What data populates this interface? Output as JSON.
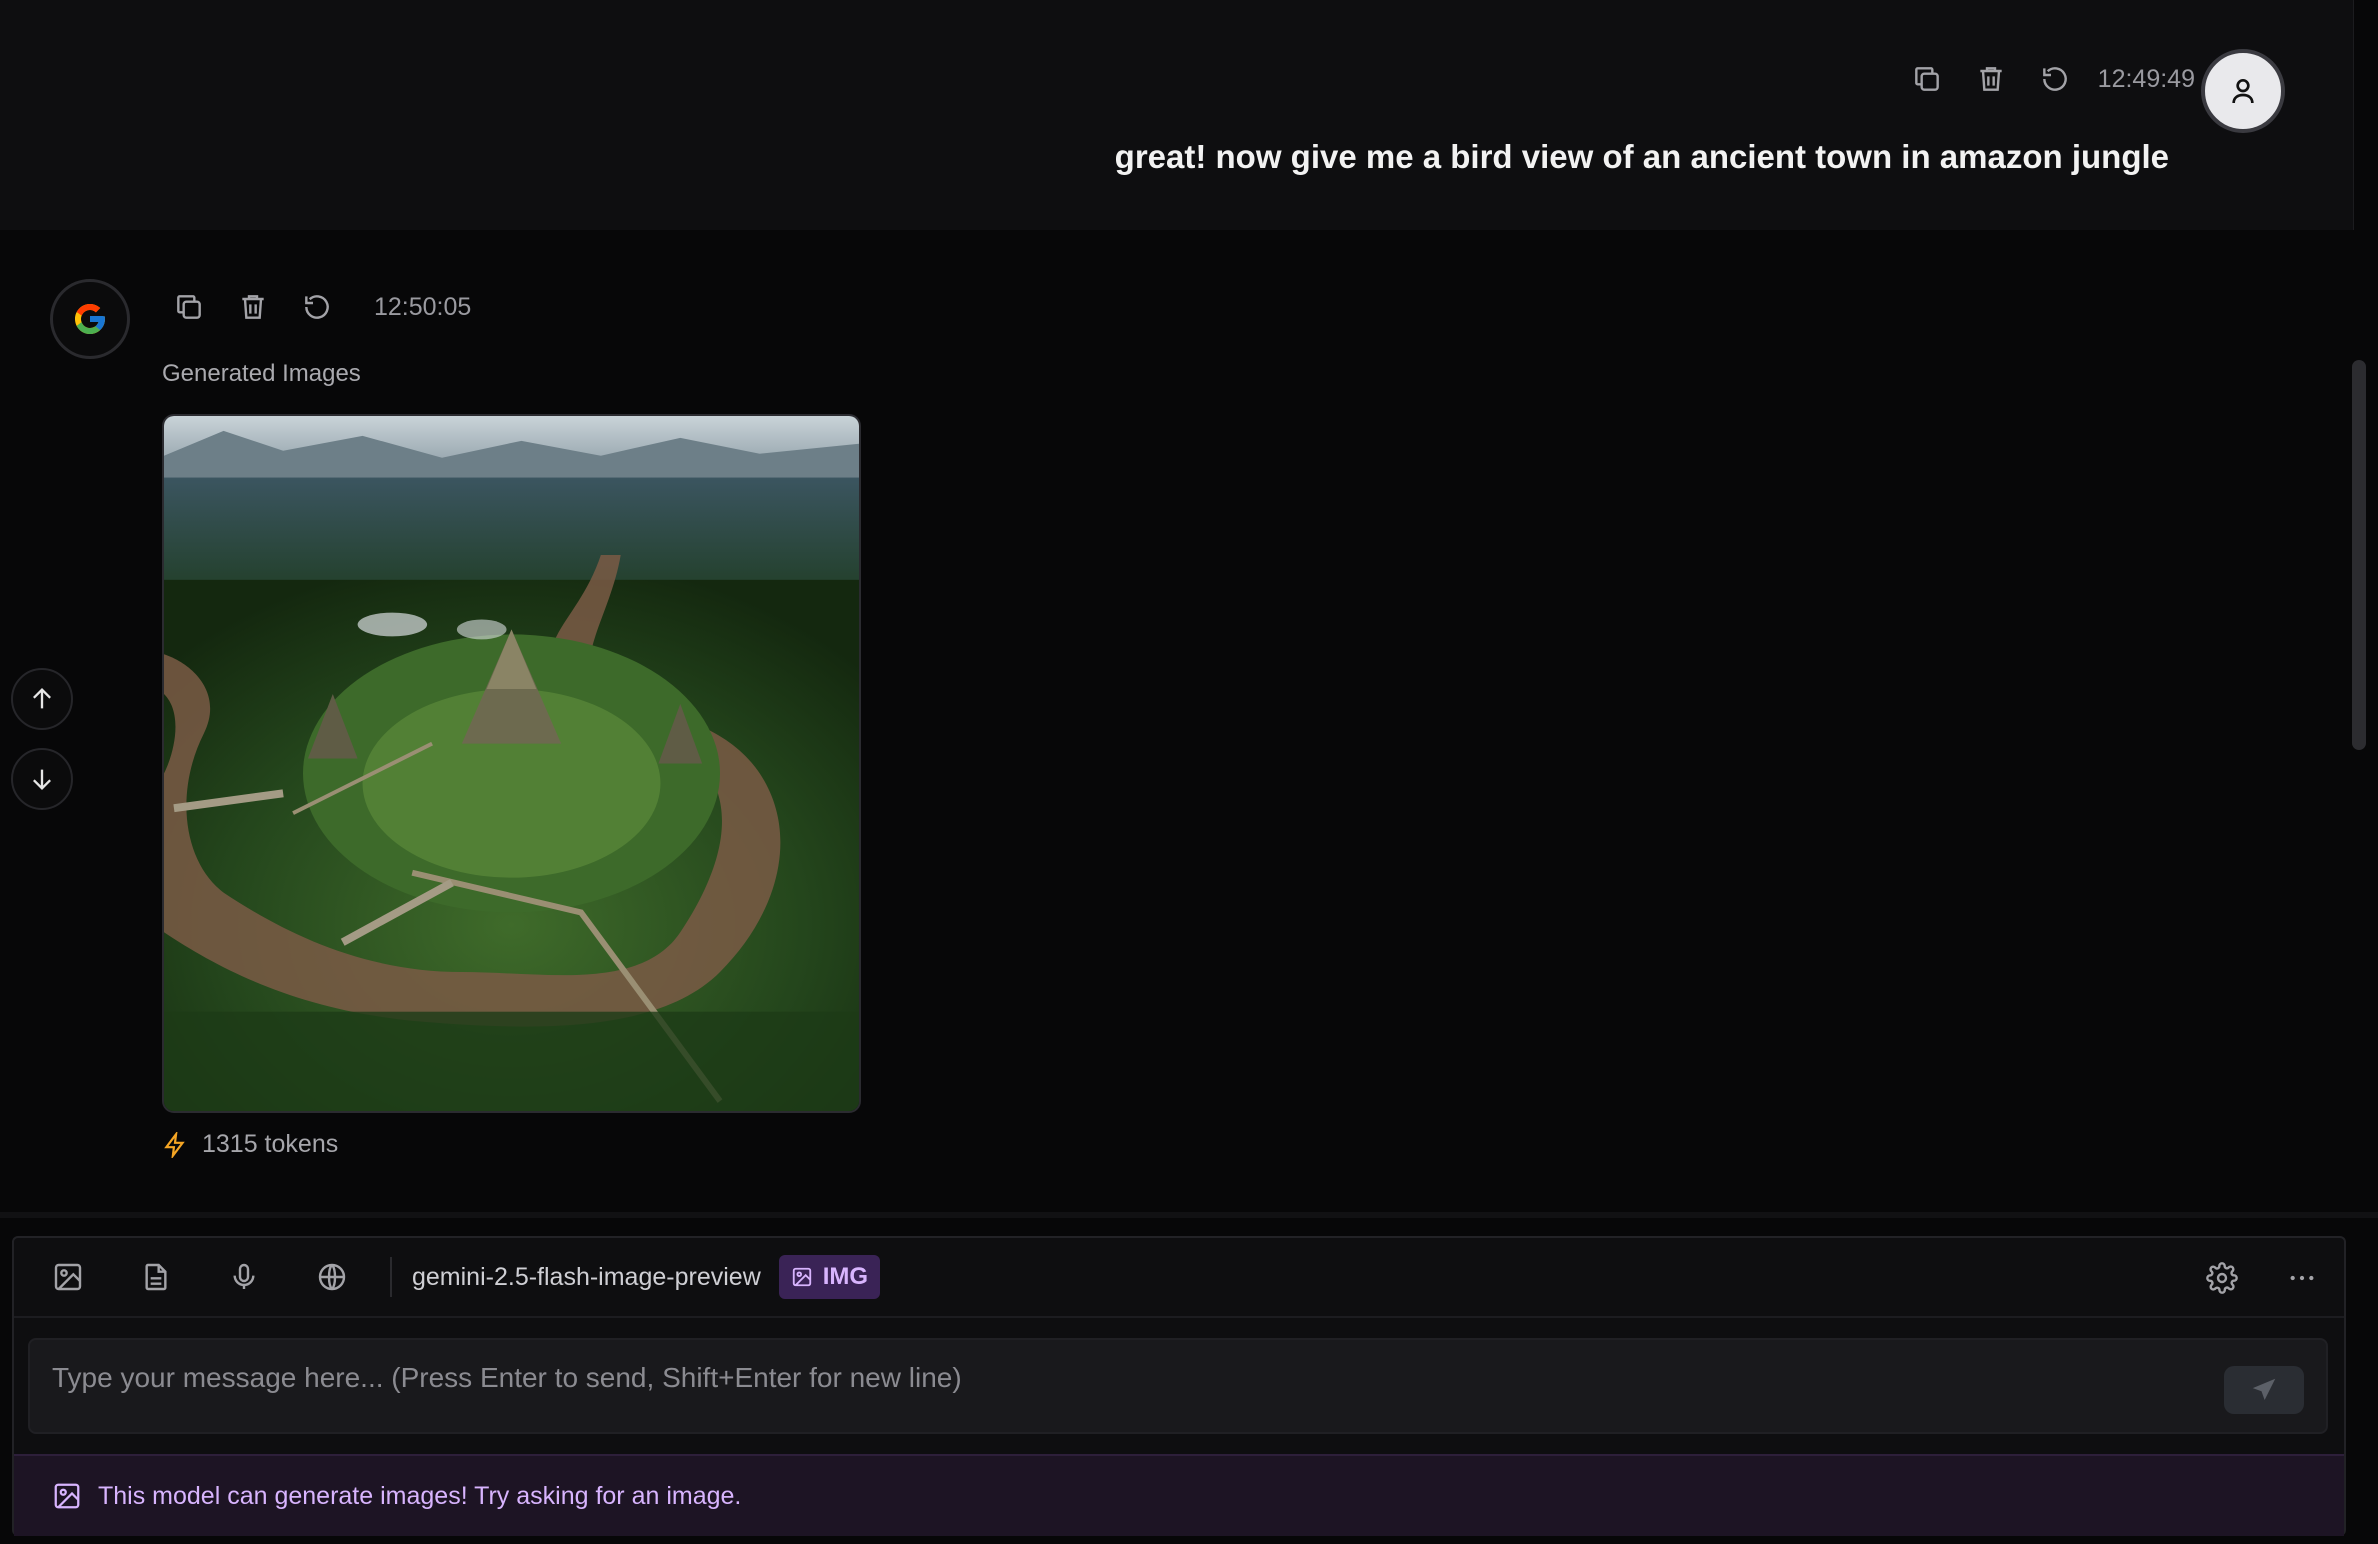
{
  "user_message": {
    "text": "great! now give me a bird view of an ancient town in amazon jungle",
    "timestamp": "12:49:49",
    "actions": [
      "copy-icon",
      "trash-icon",
      "retry-icon"
    ],
    "avatar_icon": "user-icon"
  },
  "assistant_message": {
    "timestamp": "12:50:05",
    "section_label": "Generated Images",
    "tokens_text": "1315 tokens",
    "avatar_icon": "google-g-icon",
    "actions": [
      "copy-icon",
      "trash-icon",
      "retry-icon"
    ]
  },
  "nav": {
    "up_icon": "arrow-up-icon",
    "down_icon": "arrow-down-icon"
  },
  "composer": {
    "model_name": "gemini-2.5-flash-image-preview",
    "badge_label": "IMG",
    "placeholder": "Type your message here... (Press Enter to send, Shift+Enter for new line)",
    "value": "",
    "toolbar_icons": [
      "image-icon",
      "document-icon",
      "microphone-icon",
      "globe-icon"
    ],
    "right_icons": [
      "settings-icon",
      "more-icon"
    ],
    "hint_text": "This model can generate images! Try asking for an image."
  },
  "colors": {
    "background": "#070708",
    "user_block": "#0e0e10",
    "accent_purple": "#d8b4fe",
    "badge_bg": "#3a2356",
    "token_icon": "#f5a524"
  }
}
